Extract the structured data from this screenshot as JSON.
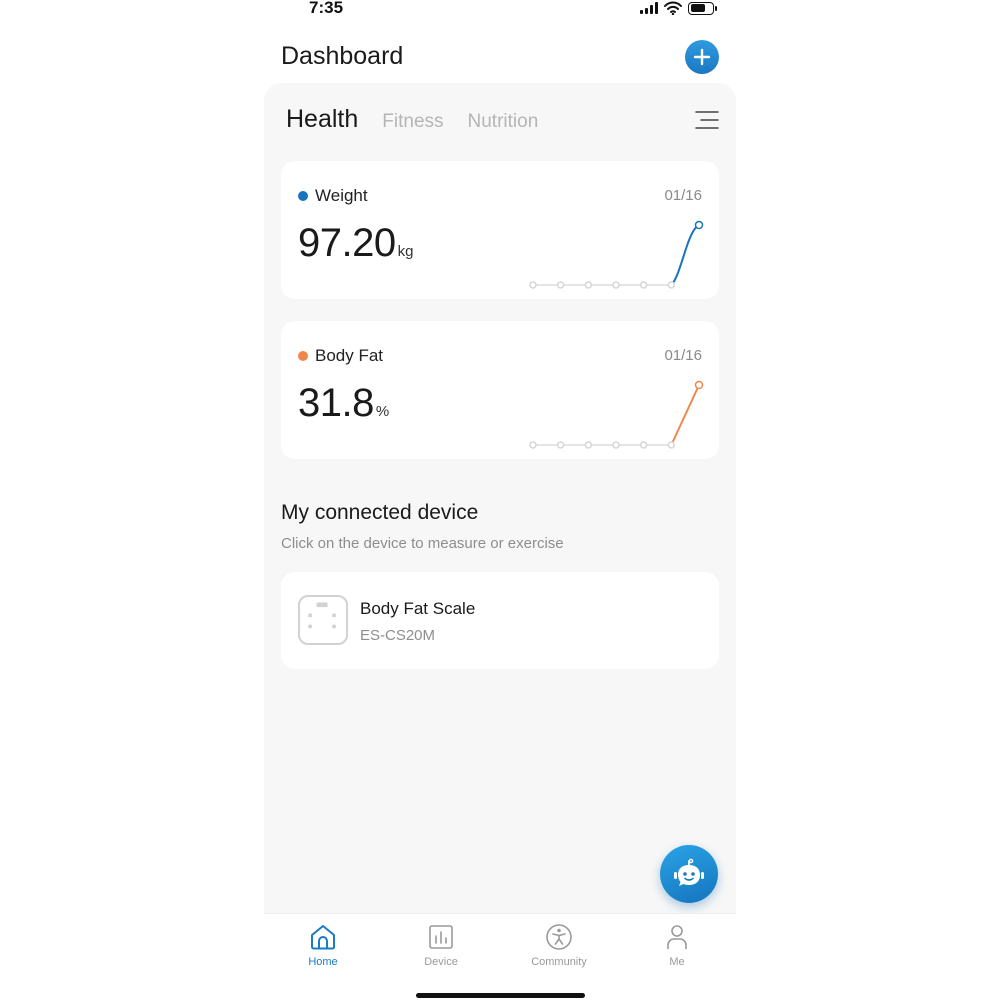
{
  "status_bar": {
    "time": "7:35"
  },
  "header": {
    "title": "Dashboard"
  },
  "tabs": [
    {
      "label": "Health",
      "active": true
    },
    {
      "label": "Fitness",
      "active": false
    },
    {
      "label": "Nutrition",
      "active": false
    }
  ],
  "metrics": [
    {
      "label": "Weight",
      "date": "01/16",
      "value": "97.20",
      "unit": "kg",
      "color": "#1a73bd",
      "trend": [
        0,
        0,
        0,
        0,
        0,
        0,
        1
      ]
    },
    {
      "label": "Body Fat",
      "date": "01/16",
      "value": "31.8",
      "unit": "%",
      "color": "#f0874a",
      "trend": [
        0,
        0,
        0,
        0,
        0,
        0,
        1
      ]
    }
  ],
  "devices_section": {
    "title": "My connected device",
    "subtitle": "Click on the device to measure or exercise",
    "devices": [
      {
        "name": "Body Fat Scale",
        "model": "ES-CS20M"
      }
    ]
  },
  "bottom_nav": [
    {
      "label": "Home",
      "icon": "home-icon",
      "active": true
    },
    {
      "label": "Device",
      "icon": "chart-icon",
      "active": false
    },
    {
      "label": "Community",
      "icon": "community-icon",
      "active": false
    },
    {
      "label": "Me",
      "icon": "person-icon",
      "active": false
    }
  ],
  "colors": {
    "accent": "#1a7bc6",
    "weight": "#1a73bd",
    "body_fat": "#f0874a"
  }
}
